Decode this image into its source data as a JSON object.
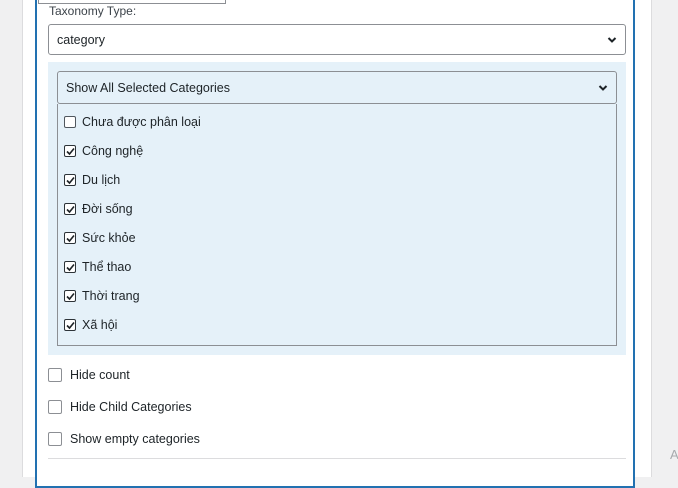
{
  "taxonomy": {
    "label": "Taxonomy Type:",
    "selected": "category"
  },
  "categories": {
    "filter_selected": "Show All Selected Categories",
    "items": [
      {
        "label": "Chưa được phân loại",
        "checked": false
      },
      {
        "label": "Công nghệ",
        "checked": true
      },
      {
        "label": "Du lịch",
        "checked": true
      },
      {
        "label": "Đời sống",
        "checked": true
      },
      {
        "label": "Sức khỏe",
        "checked": true
      },
      {
        "label": "Thể thao",
        "checked": true
      },
      {
        "label": "Thời trang",
        "checked": true
      },
      {
        "label": "Xã hội",
        "checked": true
      }
    ]
  },
  "options": {
    "hide_count": "Hide count",
    "hide_child": "Hide Child Categories",
    "show_empty": "Show empty categories"
  },
  "side_glyph": "A"
}
